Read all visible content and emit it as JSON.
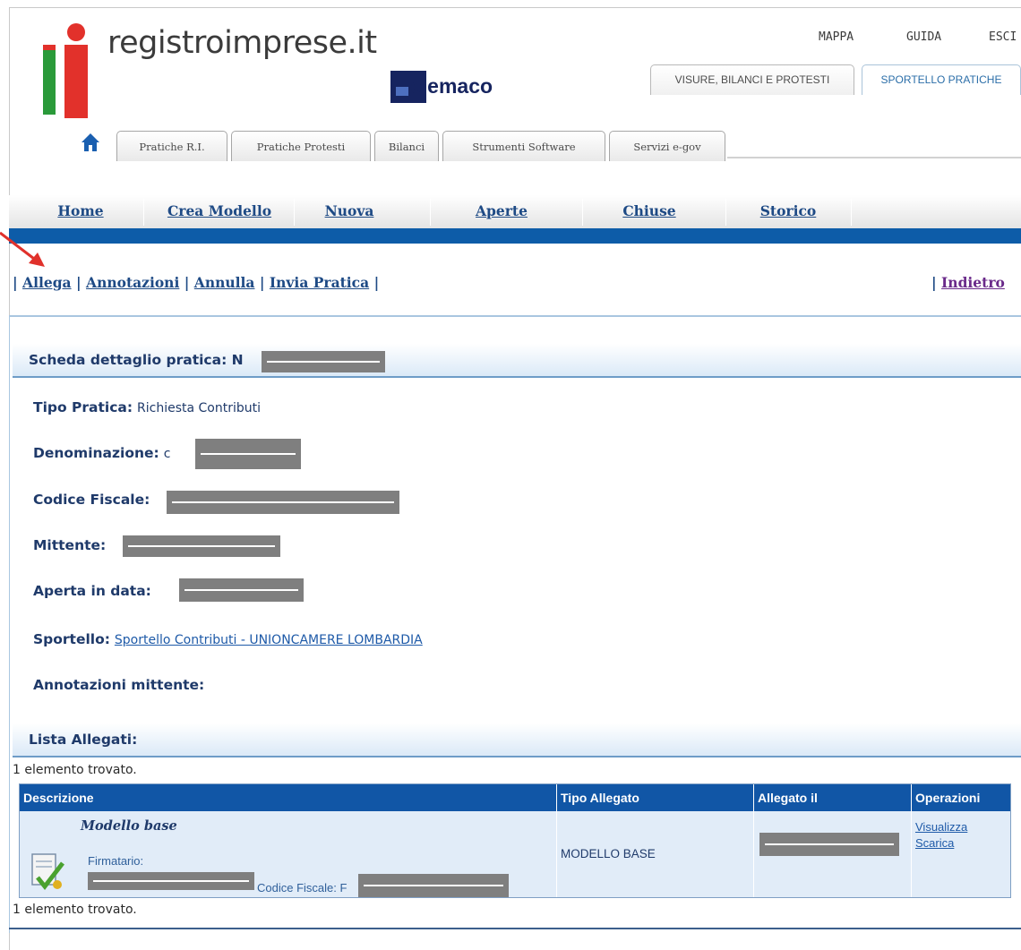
{
  "brand": {
    "site_name": "registroimprese.it",
    "product_name": "elemaco"
  },
  "top_links": [
    "MAPPA",
    "GUIDA",
    "ESCI"
  ],
  "main_tabs": [
    {
      "label": "VISURE, BILANCI E PROTESTI",
      "active": false
    },
    {
      "label": "SPORTELLO PRATICHE",
      "active": true
    }
  ],
  "sub_tabs": [
    "Pratiche R.I.",
    "Pratiche Protesti",
    "Bilanci",
    "Strumenti Software",
    "Servizi e-gov"
  ],
  "nav": [
    "Home",
    "Crea Modello",
    "Nuova",
    "Aperte",
    "Chiuse",
    "Storico"
  ],
  "actions": [
    "Allega",
    "Annotazioni",
    "Annulla",
    "Invia Pratica"
  ],
  "back_label": "Indietro",
  "detail": {
    "header": "Scheda dettaglio pratica: N",
    "tipo_pratica_label": "Tipo Pratica:",
    "tipo_pratica_value": "Richiesta Contributi",
    "denominazione_label": "Denominazione:",
    "denominazione_prefix": "c",
    "codice_fiscale_label": "Codice Fiscale:",
    "mittente_label": "Mittente:",
    "aperta_label": "Aperta in data:",
    "sportello_label": "Sportello:",
    "sportello_value": "Sportello Contributi - UNIONCAMERE LOMBARDIA",
    "annotazioni_label": "Annotazioni mittente:"
  },
  "attachments": {
    "header": "Lista Allegati:",
    "count_text": "1 elemento trovato.",
    "columns": [
      "Descrizione",
      "Tipo Allegato",
      "Allegato il",
      "Operazioni"
    ],
    "rows": [
      {
        "name": "Modello base",
        "signer_label": "Firmatario:",
        "cf_label": "Codice Fiscale: F",
        "type": "MODELLO BASE",
        "operations": [
          "Visualizza",
          "Scarica"
        ]
      }
    ]
  },
  "colors": {
    "nav_blue": "#0d5ca8",
    "header_blue": "#1156a6",
    "link_blue": "#1e4a85",
    "visited_purple": "#6a2a8a",
    "arrow_red": "#e0312b"
  }
}
